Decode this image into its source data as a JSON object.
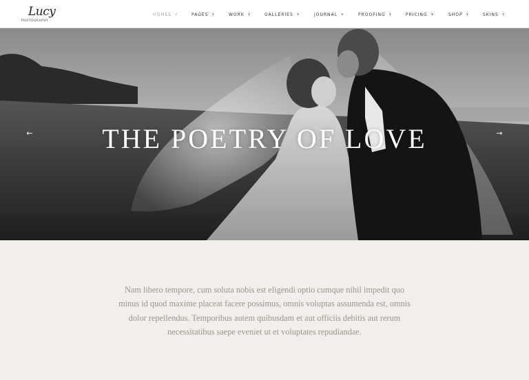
{
  "brand": {
    "logo_script": "Lucy",
    "logo_sub": "PHOTOGRAPHY"
  },
  "nav": {
    "items": [
      {
        "label": "HOMES",
        "active": true
      },
      {
        "label": "PAGES"
      },
      {
        "label": "WORK"
      },
      {
        "label": "GALLERIES"
      },
      {
        "label": "JOURNAL"
      },
      {
        "label": "PROOFING"
      },
      {
        "label": "PRICING"
      },
      {
        "label": "SHOP"
      },
      {
        "label": "SKINS"
      }
    ],
    "chevron_icon": "chevron-down-icon"
  },
  "hero": {
    "title": "THE POETRY OF LOVE",
    "prev_icon": "arrow-left-icon",
    "next_icon": "arrow-right-icon",
    "prev_glyph": "←",
    "next_glyph": "→"
  },
  "intro": {
    "lines": [
      "Nam libero tempore, cum soluta nobis est eligendi optio cumque nihil impedit quo",
      "minus id quod maxime placeat facere possimus, omnis voluptas assumenda est, omnis",
      "dolor repellendus. Temporibus autem quibusdam et aut officiis debitis aut rerum",
      "necessitatibus saepe eveniet ut et voluptates repudiandae."
    ]
  },
  "colors": {
    "header_bg": "#ffffff",
    "page_bg": "#f2eeea",
    "nav_text": "#333333",
    "nav_active": "#a8a39e",
    "intro_text": "#9a948e"
  }
}
